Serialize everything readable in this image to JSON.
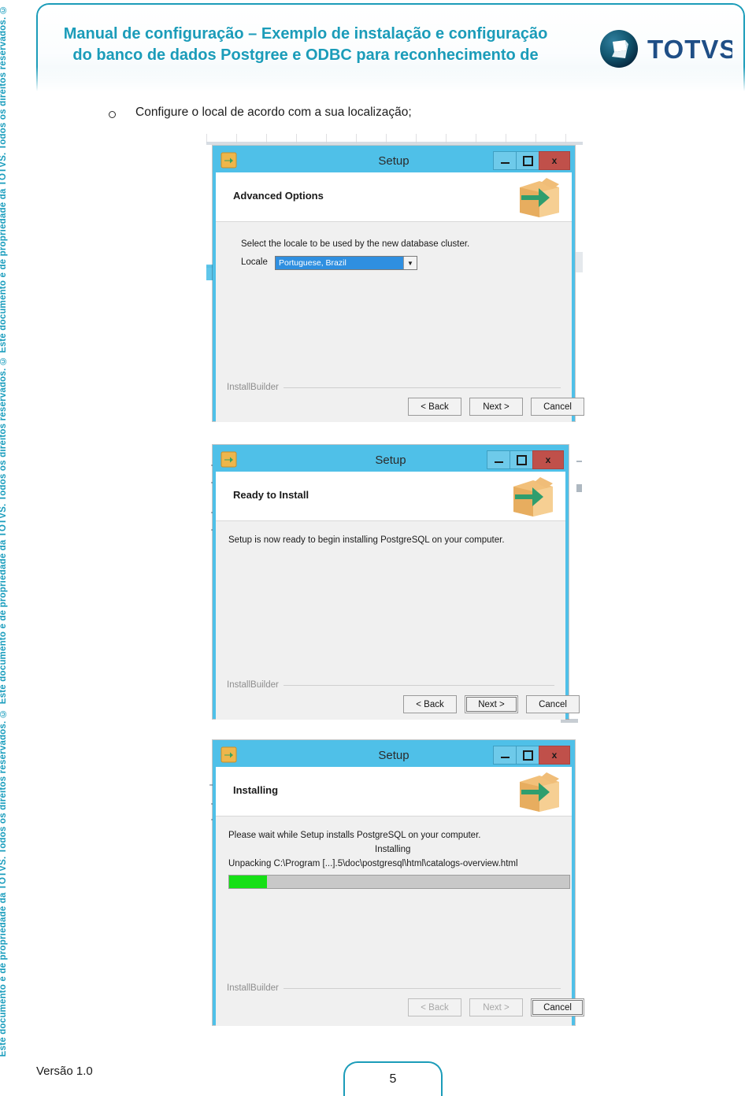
{
  "sidebar": {
    "copyright_text": "Este documento é de propriedade da TOTVS. Todos os direitos reservados. ©"
  },
  "header": {
    "title": "Manual de configuração – Exemplo de instalação e configuração do banco de dados Postgree e ODBC para reconhecimento de",
    "logo_text": "TOTVS",
    "brand_color": "#1b9cb9"
  },
  "content": {
    "bullet_marker": "o",
    "bullet_text": "Configure o local de acordo com a sua localização;"
  },
  "dialogs": [
    {
      "title": "Setup",
      "heading": "Advanced Options",
      "instruction": "Select the locale to be used by the new database cluster.",
      "locale_label": "Locale",
      "locale_value": "Portuguese, Brazil",
      "footer_brand": "InstallBuilder",
      "buttons": [
        {
          "label": "< Back",
          "state": "enabled"
        },
        {
          "label": "Next >",
          "state": "enabled"
        },
        {
          "label": "Cancel",
          "state": "enabled"
        }
      ],
      "window_controls": {
        "minimize": "–",
        "maximize": "□",
        "close": "x"
      }
    },
    {
      "title": "Setup",
      "heading": "Ready to Install",
      "instruction": "Setup is now ready to begin installing PostgreSQL on your computer.",
      "footer_brand": "InstallBuilder",
      "buttons": [
        {
          "label": "< Back",
          "state": "enabled"
        },
        {
          "label": "Next >",
          "state": "focused"
        },
        {
          "label": "Cancel",
          "state": "enabled"
        }
      ],
      "window_controls": {
        "minimize": "–",
        "maximize": "□",
        "close": "x"
      }
    },
    {
      "title": "Setup",
      "heading": "Installing",
      "instruction": "Please wait while Setup installs PostgreSQL on your computer.",
      "status": "Installing",
      "detail": "Unpacking C:\\Program [...].5\\doc\\postgresql\\html\\catalogs-overview.html",
      "progress_percent": 11,
      "footer_brand": "InstallBuilder",
      "buttons": [
        {
          "label": "< Back",
          "state": "disabled"
        },
        {
          "label": "Next >",
          "state": "disabled"
        },
        {
          "label": "Cancel",
          "state": "focused"
        }
      ],
      "window_controls": {
        "minimize": "–",
        "maximize": "□",
        "close": "x"
      }
    }
  ],
  "footer": {
    "version": "Versão 1.0",
    "page_number": "5"
  }
}
